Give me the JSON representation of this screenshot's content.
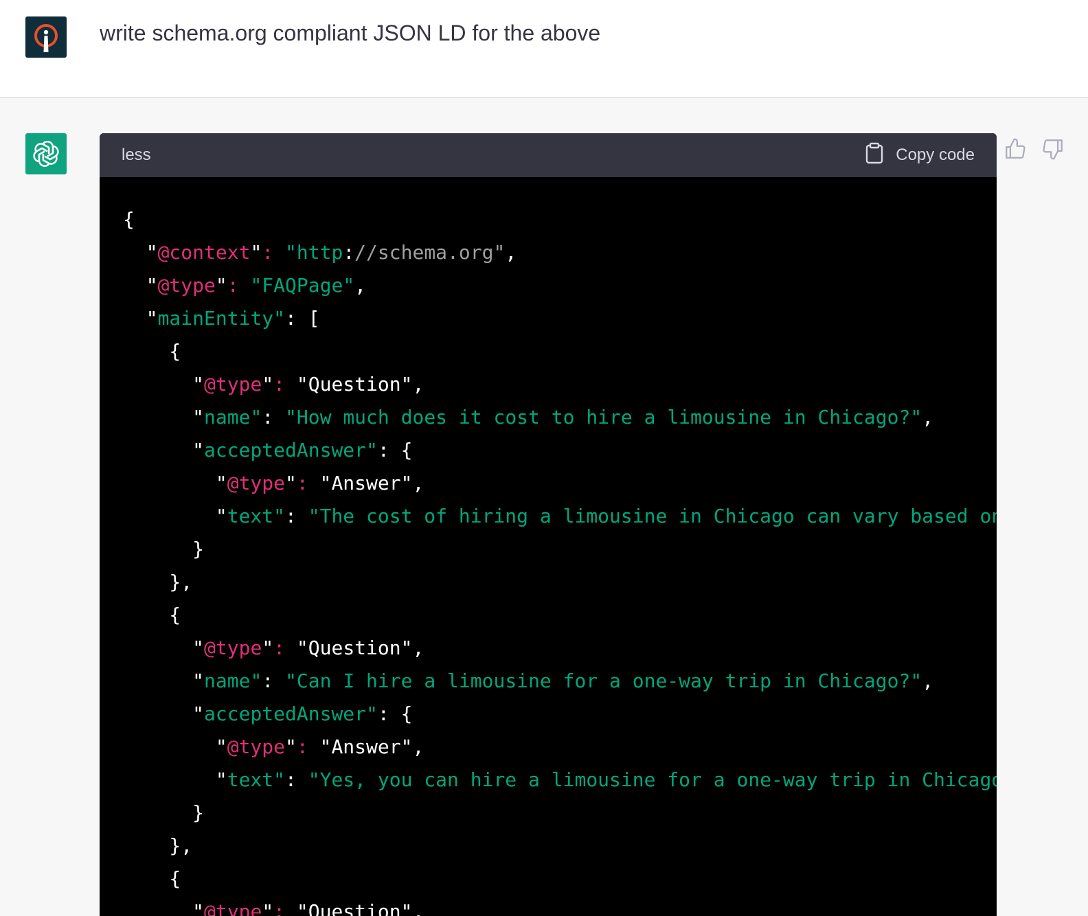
{
  "user": {
    "message": "write schema.org compliant JSON LD for the above",
    "avatar_icon": "user-avatar-icon"
  },
  "assistant": {
    "avatar_icon": "openai-logo-icon",
    "code_block": {
      "language": "less",
      "copy_label": "Copy code",
      "copy_icon": "clipboard-icon"
    }
  },
  "feedback": {
    "thumbs_up_icon": "thumbs-up-icon",
    "thumbs_down_icon": "thumbs-down-icon"
  },
  "code": {
    "lines": [
      "{",
      "  \"@context\": \"http://schema.org\",",
      "  \"@type\": \"FAQPage\",",
      "  \"mainEntity\": [",
      "    {",
      "      \"@type\": \"Question\",",
      "      \"name\": \"How much does it cost to hire a limousine in Chicago?\",",
      "      \"acceptedAnswer\": {",
      "        \"@type\": \"Answer\",",
      "        \"text\": \"The cost of hiring a limousine in Chicago can vary based on",
      "      }",
      "    },",
      "    {",
      "      \"@type\": \"Question\",",
      "      \"name\": \"Can I hire a limousine for a one-way trip in Chicago?\",",
      "      \"acceptedAnswer\": {",
      "        \"@type\": \"Answer\",",
      "        \"text\": \"Yes, you can hire a limousine for a one-way trip in Chicago",
      "      }",
      "    },",
      "    {",
      "      \"@type\": \"Question\","
    ]
  },
  "colors": {
    "key": "#00a67d",
    "at_keyword": "#df3079",
    "url": "#a0a0a0",
    "punct": "#ffffff"
  }
}
